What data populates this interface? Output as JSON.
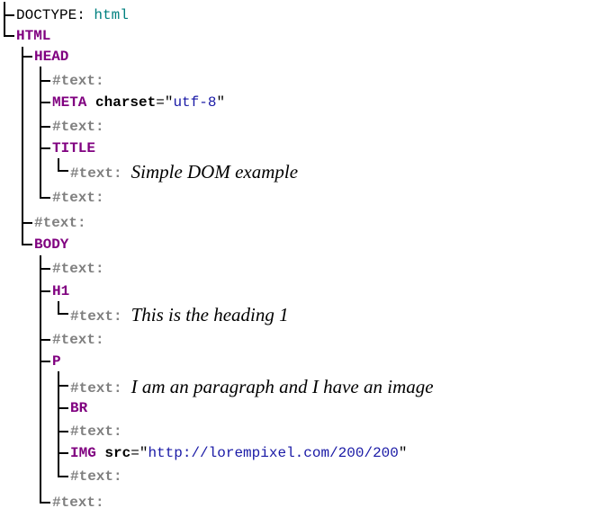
{
  "doctype": {
    "label": "DOCTYPE:",
    "value": "html"
  },
  "nodes": {
    "html": "HTML",
    "head": "HEAD",
    "text_label": "#text:",
    "meta": "META",
    "meta_attr_name": "charset",
    "meta_attr_value": "utf-8",
    "title": "TITLE",
    "title_text": "Simple DOM example",
    "body": "BODY",
    "h1": "H1",
    "h1_text": "This is the heading 1",
    "p": "P",
    "p_text": "I am an paragraph and I have an image",
    "br": "BR",
    "img": "IMG",
    "img_attr_name": "src",
    "img_attr_value": "http://lorempixel.com/200/200"
  },
  "colors": {
    "element": "#800080",
    "text_node": "#808080",
    "attr_value": "#1a1aa6",
    "doctype_value": "#00807f",
    "line": "#000000"
  }
}
